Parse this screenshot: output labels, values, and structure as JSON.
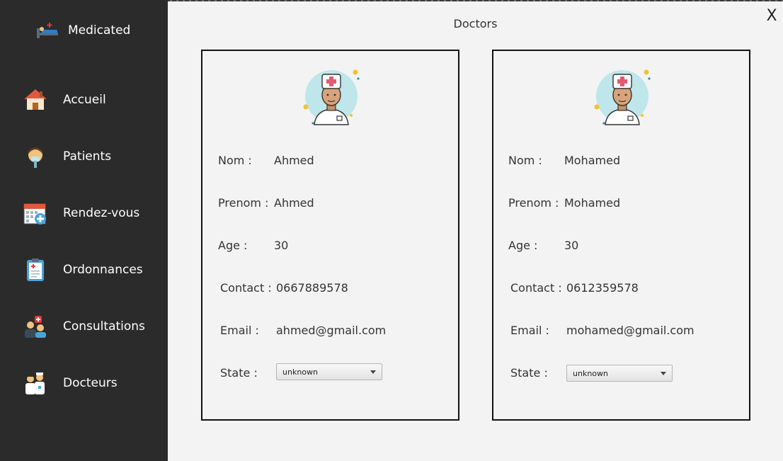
{
  "app": {
    "name": "Medicated"
  },
  "sidebar": {
    "items": [
      {
        "label": "Accueil",
        "icon": "house-icon"
      },
      {
        "label": "Patients",
        "icon": "patient-icon"
      },
      {
        "label": "Rendez-vous",
        "icon": "calendar-icon"
      },
      {
        "label": "Ordonnances",
        "icon": "clipboard-icon"
      },
      {
        "label": "Consultations",
        "icon": "consultation-icon"
      },
      {
        "label": "Docteurs",
        "icon": "doctors-icon"
      }
    ]
  },
  "main": {
    "title": "Doctors",
    "close_label": "X"
  },
  "labels": {
    "nom": "Nom :",
    "prenom": "Prenom :",
    "age": "Age :",
    "contact": "Contact :",
    "email": "Email :",
    "state": "State :"
  },
  "doctors": [
    {
      "nom": "Ahmed",
      "prenom": "Ahmed",
      "age": "30",
      "contact": "0667889578",
      "email": "ahmed@gmail.com",
      "state": "unknown"
    },
    {
      "nom": "Mohamed",
      "prenom": "Mohamed",
      "age": "30",
      "contact": "0612359578",
      "email": "mohamed@gmail.com",
      "state": "unknown"
    }
  ],
  "colors": {
    "sidebar_bg": "#2b2b2b",
    "main_bg": "#f3f3f3",
    "card_border": "#111111",
    "avatar_bg": "#bfe6ea"
  }
}
